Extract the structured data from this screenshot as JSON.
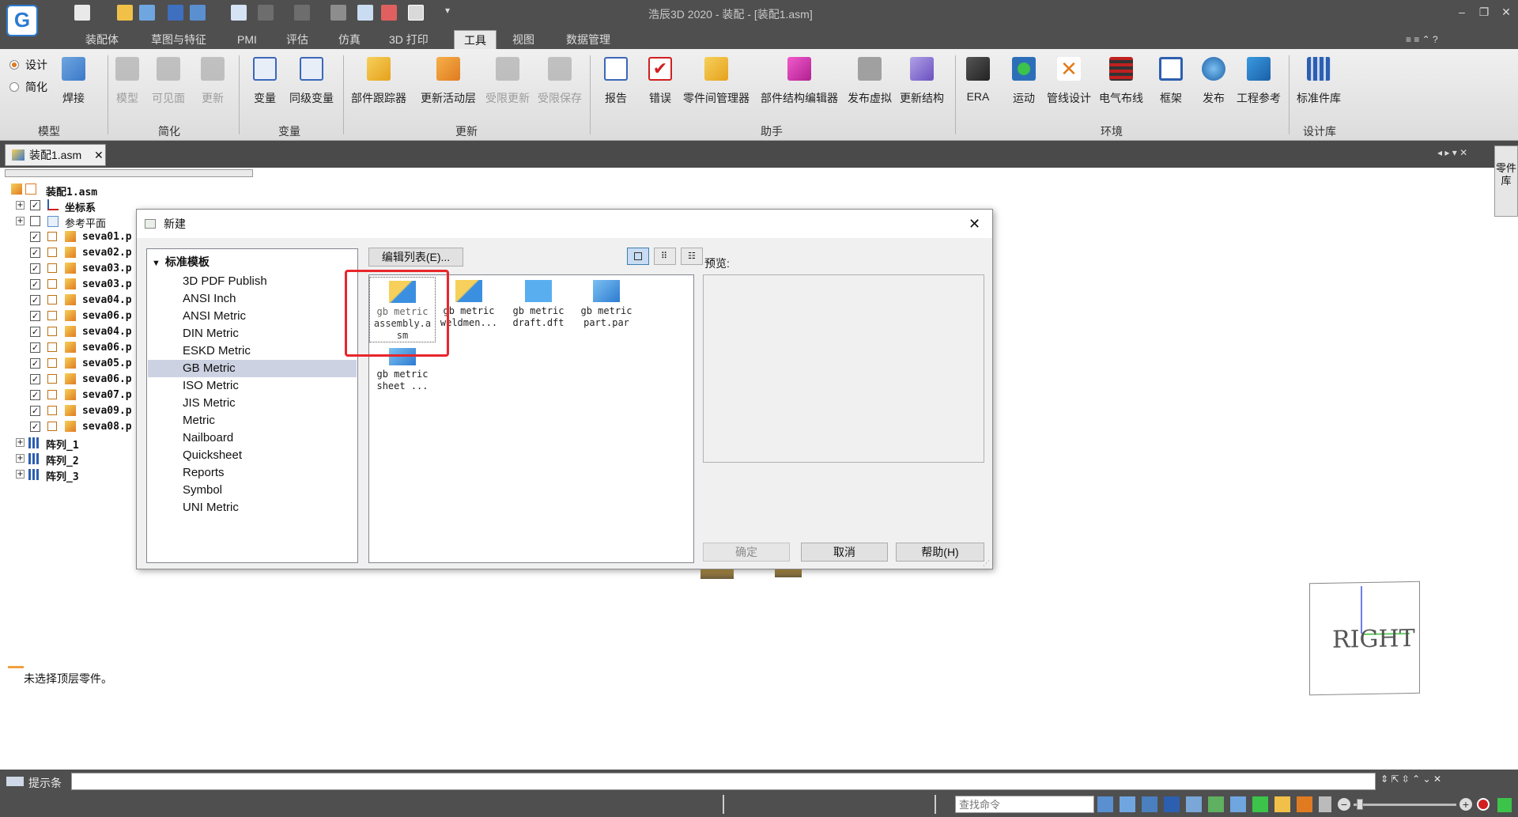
{
  "app": {
    "title": "浩辰3D 2020 - 装配 - [装配1.asm]"
  },
  "ribbon": {
    "tabs": [
      "装配体",
      "草图与特征",
      "PMI",
      "评估",
      "仿真",
      "3D 打印",
      "工具",
      "视图",
      "数据管理"
    ],
    "active_tab": "工具",
    "model_group": {
      "radio_design": "设计",
      "radio_simplify": "简化",
      "weld": "焊接",
      "label": "模型"
    },
    "simplify_group": {
      "model": "模型",
      "visible": "可见面",
      "update": "更新",
      "label": "简化"
    },
    "variable_group": {
      "variable": "变量",
      "sync_variable": "同级变量",
      "label": "变量"
    },
    "update_group": {
      "part_tracker": "部件跟踪器",
      "update_active": "更新活动层",
      "limited_update": "受限更新",
      "limited_save": "受限保存",
      "label": "更新"
    },
    "helper_group": {
      "report": "报告",
      "error": "错误",
      "part_manager": "零件间管理器",
      "structure_editor": "部件结构编辑器",
      "publish_virtual": "发布虚拟",
      "update_structure": "更新结构",
      "label": "助手"
    },
    "env_group": {
      "era": "ERA",
      "motion": "运动",
      "pipe": "管线设计",
      "wiring": "电气布线",
      "frame": "框架",
      "publish": "发布",
      "eng_ref": "工程参考",
      "label": "环境"
    },
    "library_group": {
      "std_lib": "标准件库",
      "label": "设计库"
    }
  },
  "document_tab": {
    "label": "装配1.asm"
  },
  "side_tab": {
    "label": "零件库"
  },
  "tree": {
    "root": "装配1.asm",
    "coord": "坐标系",
    "ref_plane": "参考平面",
    "parts": [
      "seva01.p",
      "seva02.p",
      "seva03.p",
      "seva03.p",
      "seva04.p",
      "seva06.p",
      "seva04.p",
      "seva06.p",
      "seva05.p",
      "seva06.p",
      "seva07.p",
      "seva09.p",
      "seva08.p"
    ],
    "patterns": [
      "阵列_1",
      "阵列_2",
      "阵列_3"
    ]
  },
  "status": {
    "message": "未选择顶层零件。"
  },
  "viewcube": {
    "label": "RIGHT"
  },
  "dialog": {
    "title": "新建",
    "tree_root": "标准模板",
    "templates": [
      "3D PDF Publish",
      "ANSI Inch",
      "ANSI Metric",
      "DIN Metric",
      "ESKD Metric",
      "GB Metric",
      "ISO Metric",
      "JIS Metric",
      "Metric",
      "Nailboard",
      "Quicksheet",
      "Reports",
      "Symbol",
      "UNI Metric"
    ],
    "selected_template": "GB Metric",
    "edit_list_button": "编辑列表(E)...",
    "preview_label": "预览:",
    "files": [
      {
        "name": "gb metric assembly.asm",
        "line1": "gb metric",
        "line2": "assembly.a",
        "line3": "sm"
      },
      {
        "name": "gb metric weldment",
        "line1": "gb metric",
        "line2": "weldmen..."
      },
      {
        "name": "gb metric draft.dft",
        "line1": "gb metric",
        "line2": "draft.dft"
      },
      {
        "name": "gb metric part.par",
        "line1": "gb metric",
        "line2": "part.par"
      },
      {
        "name": "gb metric sheet",
        "line1": "gb metric",
        "line2": "sheet ..."
      }
    ],
    "ok_button": "确定",
    "cancel_button": "取消",
    "help_button": "帮助(H)"
  },
  "hint_bar": {
    "label": "提示条"
  },
  "command_search": {
    "placeholder": "查找命令"
  },
  "colors": {
    "highlight_box": "#e8262b",
    "accent_blue": "#2d7bd2",
    "chrome_dark": "#4f4f4f"
  }
}
